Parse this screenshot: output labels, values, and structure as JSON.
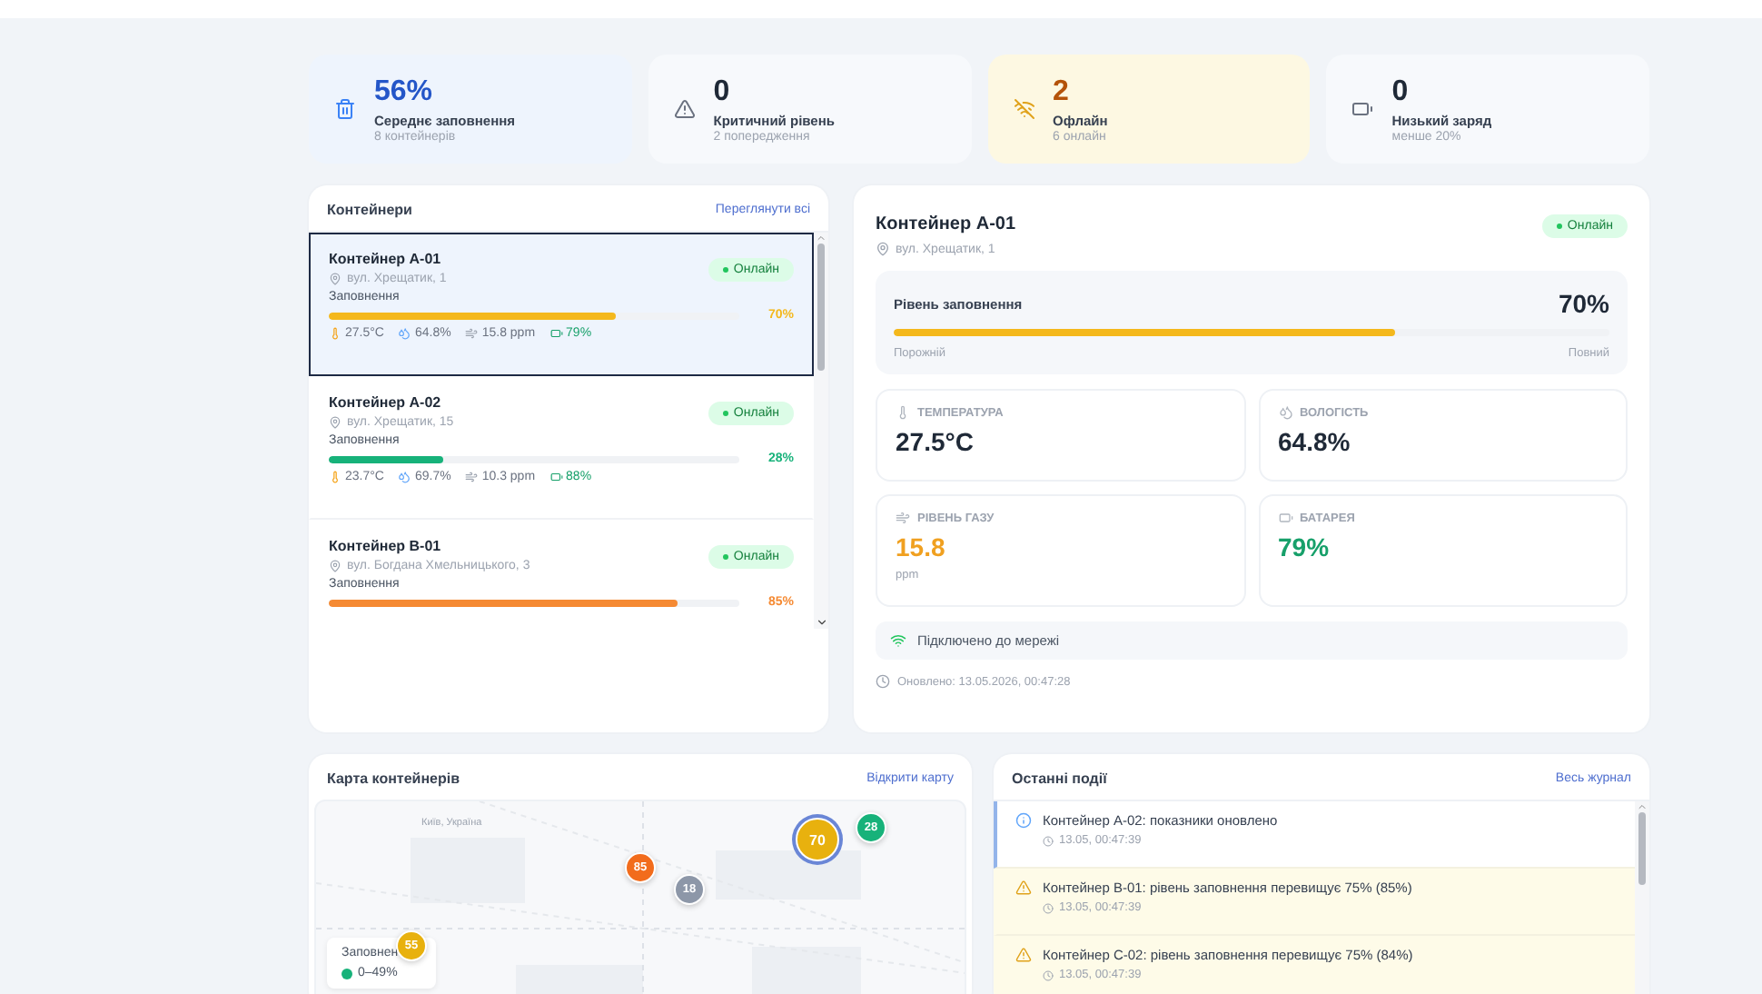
{
  "stats": [
    {
      "kind": "fill",
      "value": "56%",
      "label": "Середнє заповнення",
      "sub": "8 контейнерів"
    },
    {
      "kind": "critical",
      "value": "0",
      "label": "Критичний рівень",
      "sub": "2 попередження"
    },
    {
      "kind": "offline",
      "value": "2",
      "label": "Офлайн",
      "sub": "6 онлайн"
    },
    {
      "kind": "battery",
      "value": "0",
      "label": "Низький заряд",
      "sub": "менше 20%"
    }
  ],
  "containers": {
    "title": "Контейнери",
    "link": "Переглянути всі",
    "items": [
      {
        "name": "Контейнер A-01",
        "fill_label": "Заповнення",
        "address": "вул. Хрещатик, 1",
        "status": "Онлайн",
        "online": true,
        "selected": true,
        "level": 0.7,
        "percent": "70%",
        "color": "#f4b81c",
        "temp": "27.5°C",
        "humidity": "64.8%",
        "gas": "15.8 ppm",
        "battery": "79%"
      },
      {
        "name": "Контейнер A-02",
        "fill_label": "Заповнення",
        "address": "вул. Хрещатик, 15",
        "status": "Онлайн",
        "online": true,
        "selected": false,
        "level": 0.28,
        "percent": "28%",
        "color": "#17b27a",
        "temp": "23.7°C",
        "humidity": "69.7%",
        "gas": "10.3 ppm",
        "battery": "88%"
      },
      {
        "name": "Контейнер B-01",
        "fill_label": "Заповнення",
        "address": "вул. Богдана Хмельницького, 3",
        "status": "Онлайн",
        "online": true,
        "selected": false,
        "level": 0.85,
        "percent": "85%",
        "color": "#f58a33"
      }
    ]
  },
  "detail": {
    "name": "Контейнер A-01",
    "address": "вул. Хрещатик, 1",
    "status": "Онлайн",
    "online": true,
    "fill": {
      "label": "Рівень заповнення",
      "value": "70%",
      "level": 0.7,
      "min_label": "Порожній",
      "max_label": "Повний"
    },
    "metrics": [
      {
        "kind": "temperature",
        "label": "ТЕМПЕРАТУРА",
        "value": "27.5°C"
      },
      {
        "kind": "humidity",
        "label": "ВОЛОГІСТЬ",
        "value": "64.8%"
      },
      {
        "kind": "gas",
        "label": "РІВЕНЬ ГАЗУ",
        "value": "15.8",
        "unit": "ppm"
      },
      {
        "kind": "battery",
        "label": "БАТАРЕЯ",
        "value": "79%"
      }
    ],
    "connection": "Підключено до мережі",
    "updated": "Оновлено: 13.05.2026, 00:47:28"
  },
  "map": {
    "title": "Карта контейнерів",
    "link": "Відкрити карту",
    "place": "Київ, Україна",
    "legend_title": "Заповнен",
    "legend": [
      {
        "label": "0–49%",
        "color": "#17b27a"
      }
    ],
    "markers": [
      {
        "label": "85",
        "color": "#f26c1c"
      },
      {
        "label": "18",
        "color": "#8d97a8"
      },
      {
        "label": "70",
        "color": "#e8b10e",
        "selected": true
      },
      {
        "label": "28",
        "color": "#17b27a"
      },
      {
        "label": "55",
        "color": "#e8b10e",
        "selected": false
      }
    ]
  },
  "events": {
    "title": "Останні події",
    "link": "Весь журнал",
    "items": [
      {
        "kind": "info",
        "text": "Контейнер A-02: показники оновлено",
        "time": "13.05, 00:47:39"
      },
      {
        "kind": "warning",
        "text": "Контейнер B-01: рівень заповнення перевищує 75% (85%)",
        "time": "13.05, 00:47:39"
      },
      {
        "kind": "warning",
        "text": "Контейнер C-02: рівень заповнення перевищує 75% (84%)",
        "time": "13.05, 00:47:39"
      }
    ]
  }
}
